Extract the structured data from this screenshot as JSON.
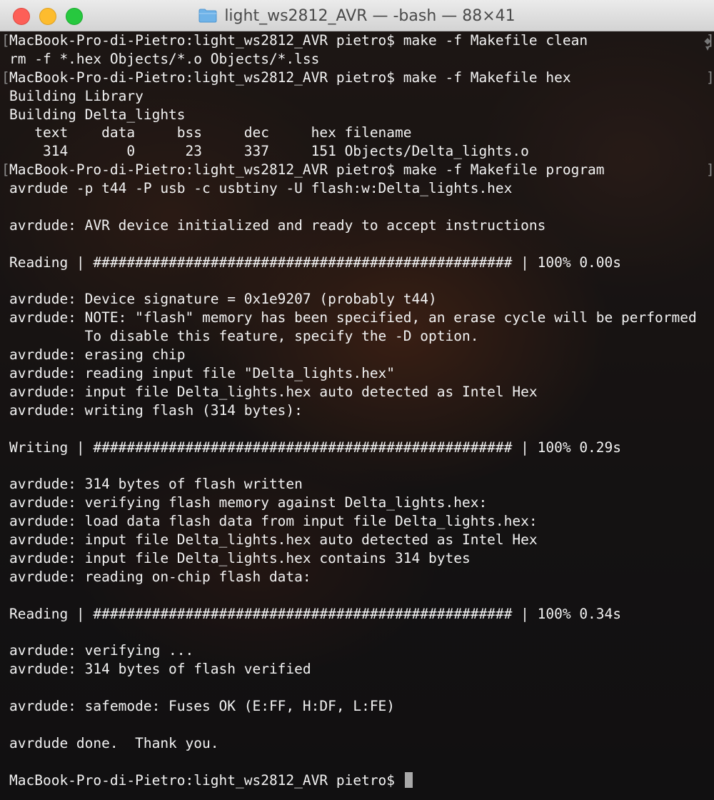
{
  "window": {
    "title": "light_ws2812_AVR — -bash — 88×41",
    "controls": [
      "close",
      "minimize",
      "zoom"
    ],
    "title_icon": "folder-icon"
  },
  "terminal": {
    "lines": [
      {
        "text": "MacBook-Pro-di-Pietro:light_ws2812_AVR pietro$ make -f Makefile clean",
        "marks": true
      },
      {
        "text": "rm -f *.hex Objects/*.o Objects/*.lss"
      },
      {
        "text": "MacBook-Pro-di-Pietro:light_ws2812_AVR pietro$ make -f Makefile hex",
        "marks": true
      },
      {
        "text": "Building Library"
      },
      {
        "text": "Building Delta_lights"
      },
      {
        "text": "   text    data     bss     dec     hex filename"
      },
      {
        "text": "    314       0      23     337     151 Objects/Delta_lights.o"
      },
      {
        "text": "MacBook-Pro-di-Pietro:light_ws2812_AVR pietro$ make -f Makefile program",
        "marks": true
      },
      {
        "text": "avrdude -p t44 -P usb -c usbtiny -U flash:w:Delta_lights.hex"
      },
      {
        "text": ""
      },
      {
        "text": "avrdude: AVR device initialized and ready to accept instructions"
      },
      {
        "text": ""
      },
      {
        "text": "Reading | ################################################## | 100% 0.00s"
      },
      {
        "text": ""
      },
      {
        "text": "avrdude: Device signature = 0x1e9207 (probably t44)"
      },
      {
        "text": "avrdude: NOTE: \"flash\" memory has been specified, an erase cycle will be performed"
      },
      {
        "text": "         To disable this feature, specify the -D option."
      },
      {
        "text": "avrdude: erasing chip"
      },
      {
        "text": "avrdude: reading input file \"Delta_lights.hex\""
      },
      {
        "text": "avrdude: input file Delta_lights.hex auto detected as Intel Hex"
      },
      {
        "text": "avrdude: writing flash (314 bytes):"
      },
      {
        "text": ""
      },
      {
        "text": "Writing | ################################################## | 100% 0.29s"
      },
      {
        "text": ""
      },
      {
        "text": "avrdude: 314 bytes of flash written"
      },
      {
        "text": "avrdude: verifying flash memory against Delta_lights.hex:"
      },
      {
        "text": "avrdude: load data flash data from input file Delta_lights.hex:"
      },
      {
        "text": "avrdude: input file Delta_lights.hex auto detected as Intel Hex"
      },
      {
        "text": "avrdude: input file Delta_lights.hex contains 314 bytes"
      },
      {
        "text": "avrdude: reading on-chip flash data:"
      },
      {
        "text": ""
      },
      {
        "text": "Reading | ################################################## | 100% 0.34s"
      },
      {
        "text": ""
      },
      {
        "text": "avrdude: verifying ..."
      },
      {
        "text": "avrdude: 314 bytes of flash verified"
      },
      {
        "text": ""
      },
      {
        "text": "avrdude: safemode: Fuses OK (E:FF, H:DF, L:FE)"
      },
      {
        "text": ""
      },
      {
        "text": "avrdude done.  Thank you."
      },
      {
        "text": ""
      },
      {
        "text": "MacBook-Pro-di-Pietro:light_ws2812_AVR pietro$ ",
        "cursor": true
      }
    ]
  },
  "colors": {
    "close": "#fd5f57",
    "minimize": "#fdbc2e",
    "zoom": "#27c83f",
    "text": "#f2f2f2",
    "cursor": "#a9a9a9",
    "folder": "#6fb3e8"
  }
}
